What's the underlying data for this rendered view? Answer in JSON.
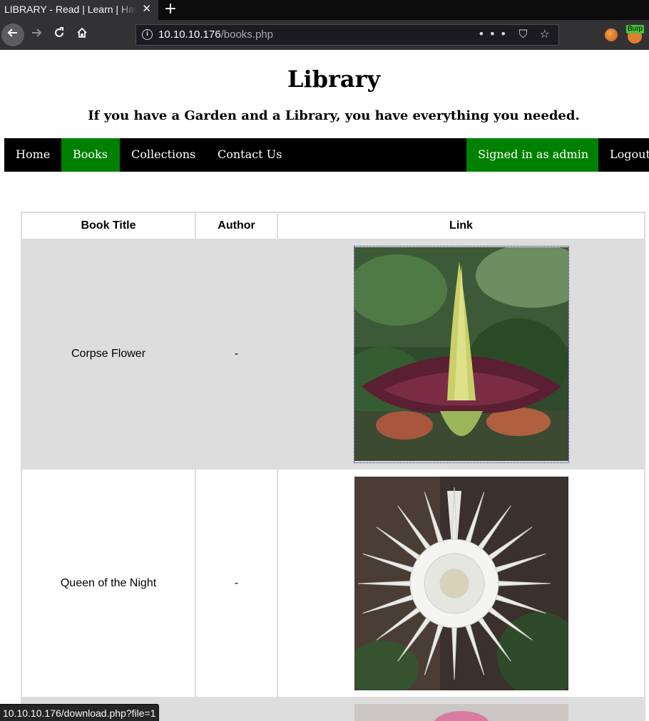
{
  "browser": {
    "tab_title": "LIBRARY - Read | Learn | Have Fun",
    "close_glyph": "✕",
    "new_tab_glyph": "+",
    "url_host": "10.10.10.176",
    "url_path": "/books.php",
    "url_icons": "••• ⛉ ☆",
    "burp_badge": "Burp",
    "status_url": "10.10.10.176/download.php?file=1"
  },
  "site": {
    "title": "Library",
    "tagline": "If you have a Garden and a Library, you have everything you needed."
  },
  "menu": {
    "home": "Home",
    "books": "Books",
    "collections": "Collections",
    "contact": "Contact Us",
    "signed_in": "Signed in as admin",
    "logout": "Logout"
  },
  "table": {
    "headers": [
      "Book Title",
      "Author",
      "Link"
    ],
    "rows": [
      {
        "title": "Corpse Flower",
        "author": "-",
        "image": "corpse-flower-image"
      },
      {
        "title": "Queen of the Night",
        "author": "-",
        "image": "queen-of-the-night-image"
      },
      {
        "title": "",
        "author": "",
        "image": "pink-flower-image"
      }
    ]
  },
  "colors": {
    "accent_green": "#008000",
    "menu_bg": "#000000",
    "row_shade": "#dddddd"
  }
}
